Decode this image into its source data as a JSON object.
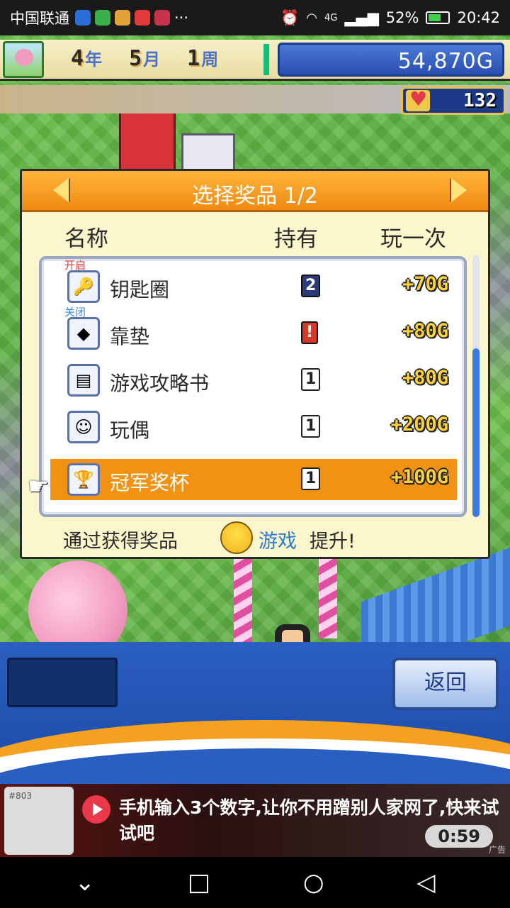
{
  "status_bar": {
    "carrier": "中国联通",
    "more": "···",
    "battery": "52%",
    "time": "20:42",
    "network": "4G"
  },
  "hud": {
    "year": "4",
    "year_unit": "年",
    "month": "5",
    "month_unit": "月",
    "week": "1",
    "week_unit": "周",
    "money": "54,870G",
    "hearts": "132"
  },
  "dialog": {
    "title": "选择奖品 1/2",
    "columns": {
      "name": "名称",
      "own": "持有",
      "play": "玩一次"
    },
    "items": [
      {
        "tag": "开启",
        "icon": "key-ring-icon",
        "name": "钥匙圈",
        "own": "2",
        "price": "+70G"
      },
      {
        "tag": "关闭",
        "icon": "cushion-icon",
        "name": "靠垫",
        "own": "!",
        "price": "+80G"
      },
      {
        "tag": "",
        "icon": "strategy-book-icon",
        "name": "游戏攻略书",
        "own": "1",
        "price": "+80G"
      },
      {
        "tag": "",
        "icon": "doll-icon",
        "name": "玩偶",
        "own": "1",
        "price": "+200G"
      },
      {
        "tag": "",
        "icon": "trophy-icon",
        "name": "冠军奖杯",
        "own": "1",
        "price": "+100G"
      }
    ],
    "footer": {
      "prefix": "通过获得奖品",
      "highlight": "游戏",
      "suffix": "提升!"
    }
  },
  "panel": {
    "back_label": "返回"
  },
  "ad": {
    "text": "手机输入3个数字,让你不用蹭别人家网了,快来试试吧",
    "time": "0:59",
    "label": "广告",
    "phone_text": "#803"
  },
  "colors": {
    "accent": "#f08a12",
    "dialog_bg": "#fbf6cc",
    "money_bg": "#2a4fb0",
    "highlight_text": "#2a7ad2"
  }
}
